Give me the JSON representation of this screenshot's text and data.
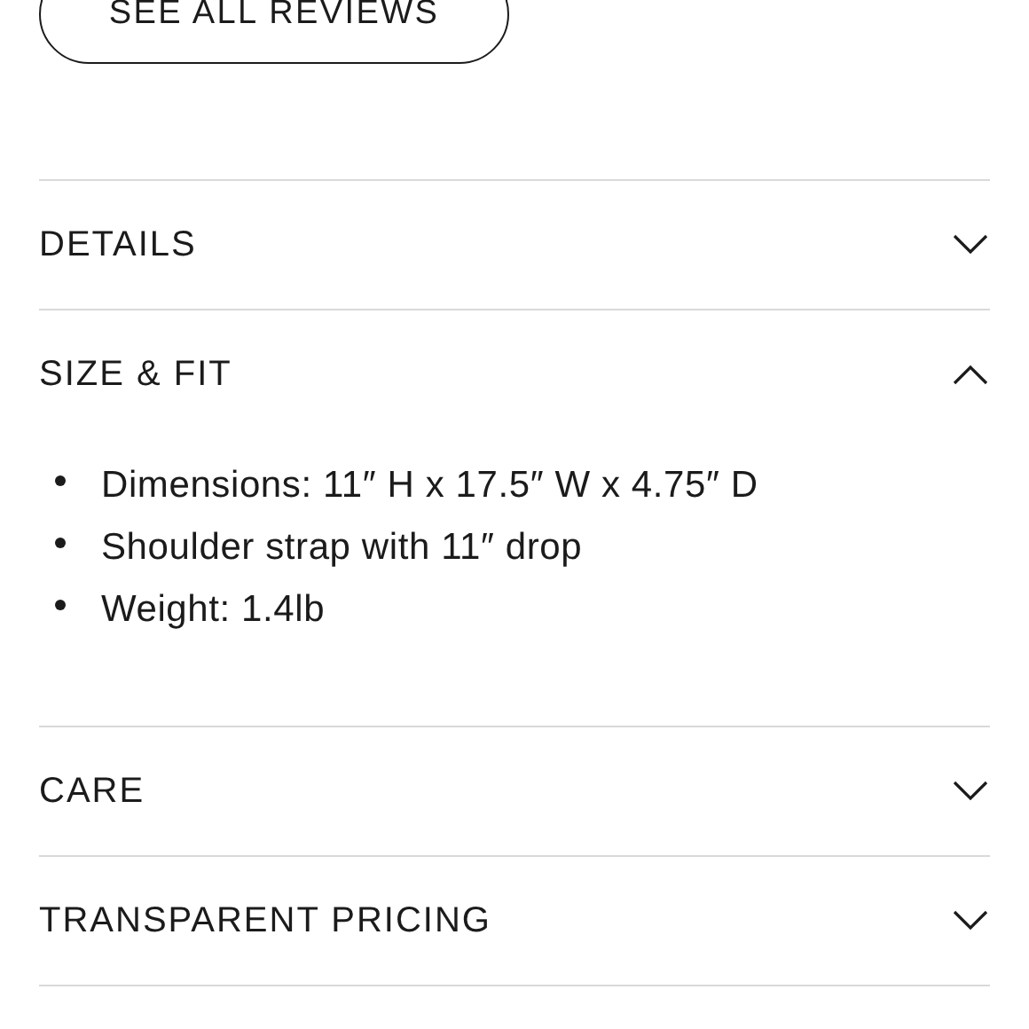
{
  "reviews_button": {
    "label": "SEE ALL REVIEWS"
  },
  "sections": [
    {
      "title": "DETAILS",
      "expanded": false
    },
    {
      "title": "SIZE & FIT",
      "expanded": true,
      "items": [
        "Dimensions: 11″ H x 17.5″ W x 4.75″ D",
        "Shoulder strap with 11″ drop",
        "Weight: 1.4lb"
      ]
    },
    {
      "title": "CARE",
      "expanded": false
    },
    {
      "title": "TRANSPARENT PRICING",
      "expanded": false
    }
  ]
}
